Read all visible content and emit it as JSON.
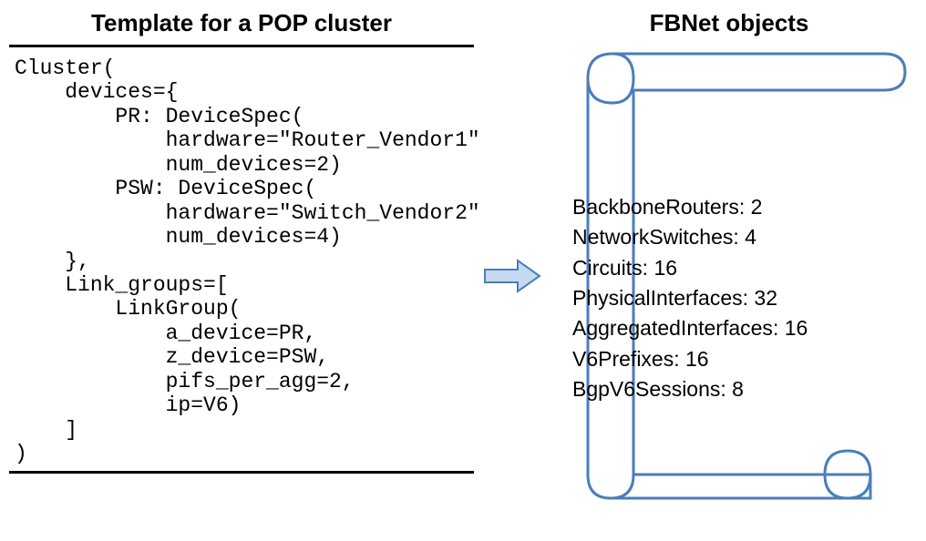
{
  "left": {
    "title": "Template for a POP cluster",
    "code": "Cluster(\n    devices={\n        PR: DeviceSpec(\n            hardware=\"Router_Vendor1\"\n            num_devices=2)\n        PSW: DeviceSpec(\n            hardware=\"Switch_Vendor2\"\n            num_devices=4)\n    },\n    Link_groups=[\n        LinkGroup(\n            a_device=PR,\n            z_device=PSW,\n            pifs_per_agg=2,\n            ip=V6)\n    ]\n)"
  },
  "right": {
    "title": "FBNet objects",
    "items": [
      {
        "label": "BackboneRouters",
        "value": "2"
      },
      {
        "label": "NetworkSwitches",
        "value": "4"
      },
      {
        "label": "Circuits",
        "value": "16"
      },
      {
        "label": "PhysicalInterfaces",
        "value": "32"
      },
      {
        "label": "AggregatedInterfaces",
        "value": "16"
      },
      {
        "label": "V6Prefixes",
        "value": "16"
      },
      {
        "label": "BgpV6Sessions",
        "value": "8"
      }
    ]
  }
}
